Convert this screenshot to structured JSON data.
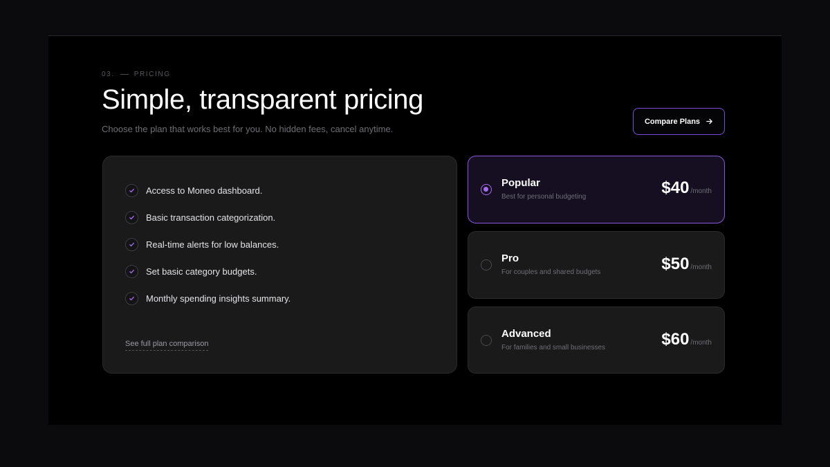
{
  "header": {
    "eyebrow_number": "03.",
    "eyebrow_label": "PRICING",
    "title": "Simple, transparent pricing",
    "subtitle": "Choose the plan that works best for you. No hidden fees, cancel anytime.",
    "compare_label": "Compare Plans"
  },
  "features": {
    "items": [
      {
        "label": "Access to Moneo dashboard."
      },
      {
        "label": "Basic transaction categorization."
      },
      {
        "label": "Real-time alerts for low balances."
      },
      {
        "label": "Set basic category budgets."
      },
      {
        "label": "Monthly spending insights summary."
      }
    ],
    "see_full_link": "See full plan comparison"
  },
  "plans": [
    {
      "name": "Popular",
      "description": "Best for personal budgeting",
      "price": "$40",
      "period": "/month",
      "selected": true
    },
    {
      "name": "Pro",
      "description": "For couples and shared budgets",
      "price": "$50",
      "period": "/month",
      "selected": false
    },
    {
      "name": "Advanced",
      "description": "For families and small businesses",
      "price": "$60",
      "period": "/month",
      "selected": false
    }
  ],
  "colors": {
    "accent": "#8a58e0",
    "background": "#000000",
    "card": "#1a1a1b"
  }
}
